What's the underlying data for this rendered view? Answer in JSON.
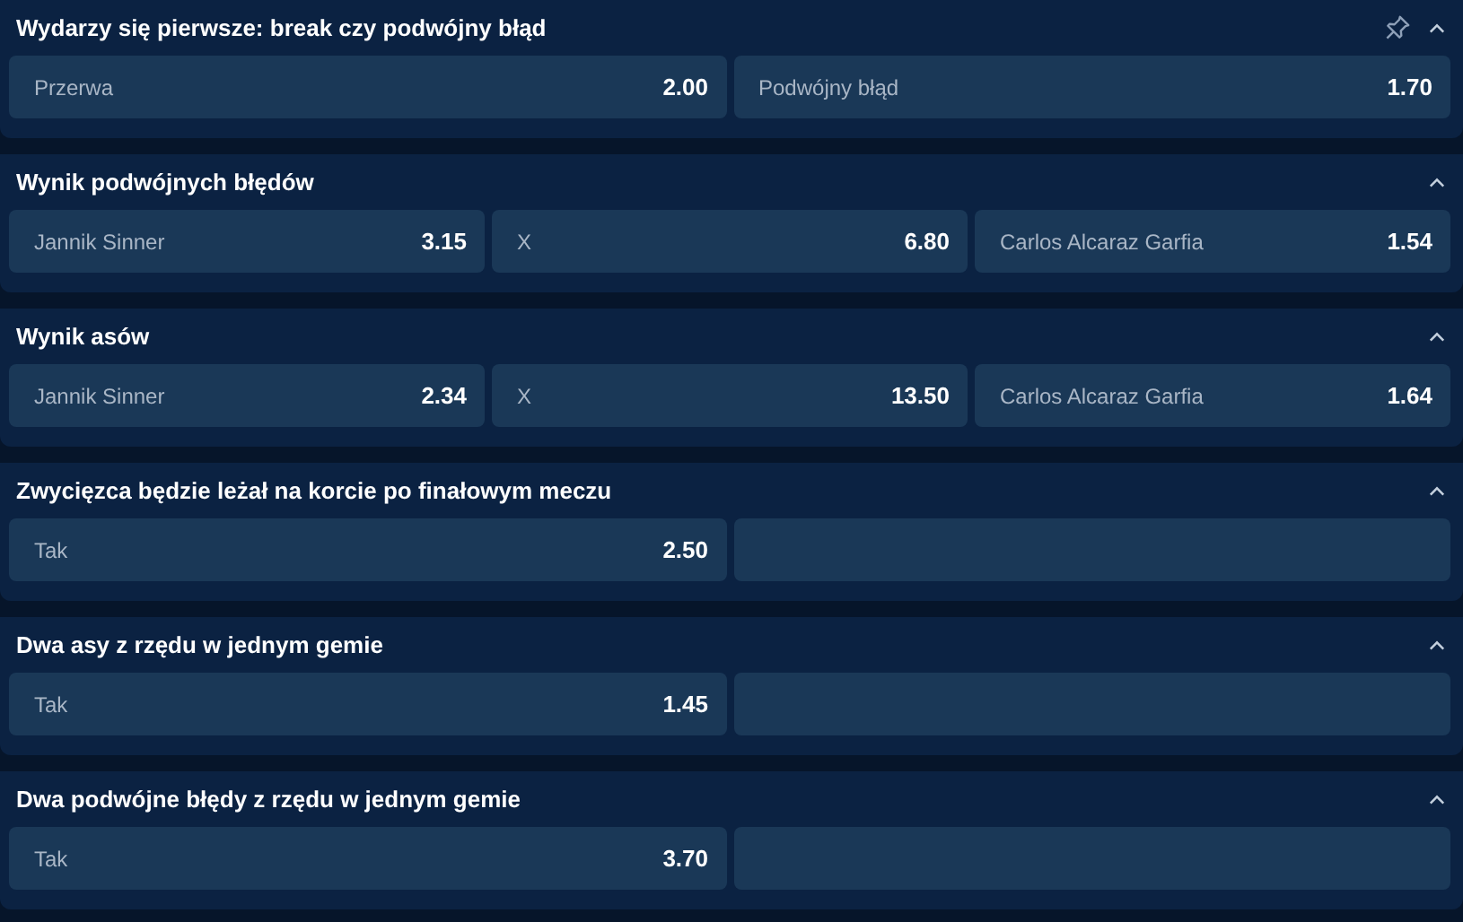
{
  "markets": [
    {
      "title": "Wydarzy się pierwsze: break czy podwójny błąd",
      "pinnable": true,
      "expanded": true,
      "outcomes": [
        {
          "kind": "odds",
          "label": "Przerwa",
          "odds": "2.00"
        },
        {
          "kind": "odds",
          "label": "Podwójny błąd",
          "odds": "1.70"
        }
      ]
    },
    {
      "title": "Wynik podwójnych błędów",
      "pinnable": false,
      "expanded": true,
      "outcomes": [
        {
          "kind": "odds",
          "label": "Jannik Sinner",
          "odds": "3.15"
        },
        {
          "kind": "odds",
          "label": "X",
          "odds": "6.80"
        },
        {
          "kind": "odds",
          "label": "Carlos Alcaraz Garfia",
          "odds": "1.54"
        }
      ]
    },
    {
      "title": "Wynik asów",
      "pinnable": false,
      "expanded": true,
      "outcomes": [
        {
          "kind": "odds",
          "label": "Jannik Sinner",
          "odds": "2.34"
        },
        {
          "kind": "odds",
          "label": "X",
          "odds": "13.50"
        },
        {
          "kind": "odds",
          "label": "Carlos Alcaraz Garfia",
          "odds": "1.64"
        }
      ]
    },
    {
      "title": "Zwycięzca będzie leżał na korcie po finałowym meczu",
      "pinnable": false,
      "expanded": true,
      "outcomes": [
        {
          "kind": "odds",
          "label": "Tak",
          "odds": "2.50"
        },
        {
          "kind": "empty"
        }
      ]
    },
    {
      "title": "Dwa asy z rzędu w jednym gemie",
      "pinnable": false,
      "expanded": true,
      "outcomes": [
        {
          "kind": "odds",
          "label": "Tak",
          "odds": "1.45"
        },
        {
          "kind": "empty"
        }
      ]
    },
    {
      "title": "Dwa podwójne błędy z rzędu w jednym gemie",
      "pinnable": false,
      "expanded": true,
      "outcomes": [
        {
          "kind": "odds",
          "label": "Tak",
          "odds": "3.70"
        },
        {
          "kind": "empty"
        }
      ]
    }
  ]
}
